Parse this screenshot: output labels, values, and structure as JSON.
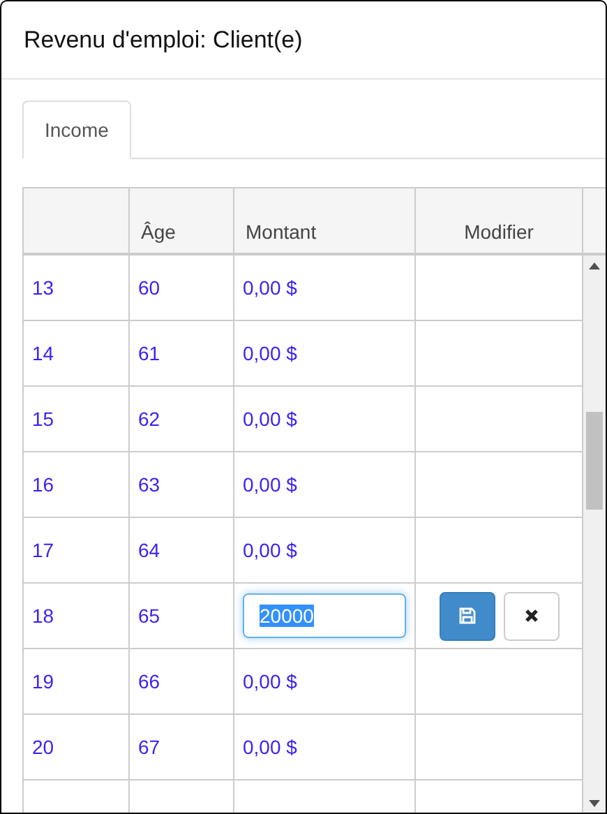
{
  "dialog": {
    "title": "Revenu d'emploi: Client(e)"
  },
  "tabs": [
    {
      "label": "Income",
      "selected": true
    }
  ],
  "table": {
    "columns": [
      "",
      "Âge",
      "Montant",
      "Modifier"
    ],
    "rows": [
      {
        "kind": "view",
        "column_1": "13",
        "age": "60",
        "amount": "0,00 $"
      },
      {
        "kind": "view",
        "column_1": "14",
        "age": "61",
        "amount": "0,00 $"
      },
      {
        "kind": "view",
        "column_1": "15",
        "age": "62",
        "amount": "0,00 $"
      },
      {
        "kind": "view",
        "column_1": "16",
        "age": "63",
        "amount": "0,00 $"
      },
      {
        "kind": "view",
        "column_1": "17",
        "age": "64",
        "amount": "0,00 $"
      },
      {
        "kind": "edit",
        "column_1": "18",
        "age": "65",
        "amount": "20000"
      },
      {
        "kind": "view",
        "column_1": "19",
        "age": "66",
        "amount": "0,00 $"
      },
      {
        "kind": "view",
        "column_1": "20",
        "age": "67",
        "amount": "0,00 $"
      }
    ]
  }
}
